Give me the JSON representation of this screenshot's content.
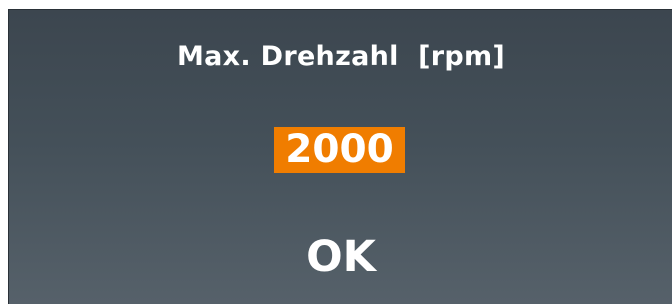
{
  "dialog": {
    "title": "Max. Drehzahl  [rpm]",
    "value": "2000",
    "ok_label": "OK"
  },
  "colors": {
    "background": "#445059",
    "highlight": "#f07d00",
    "text": "#ffffff"
  }
}
